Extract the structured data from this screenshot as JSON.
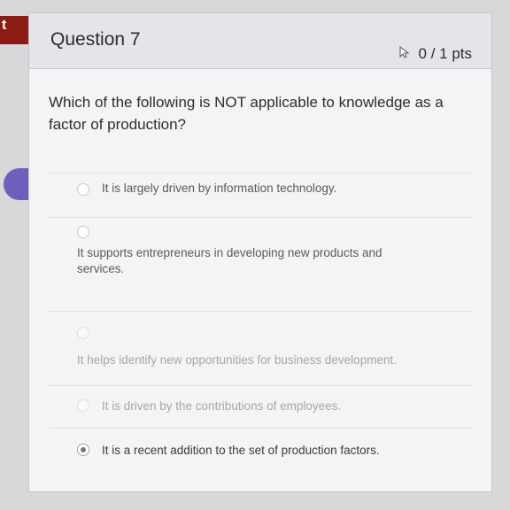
{
  "page": {
    "left_tab_label": "t",
    "question_number": "Question 7",
    "points": "0 / 1 pts",
    "question_text": "Which of the following is NOT applicable to knowledge as a factor of production?"
  },
  "answers": [
    {
      "label": "It is largely driven by information technology.",
      "selected": false
    },
    {
      "label": "It supports entrepreneurs in developing new products and services.",
      "selected": false
    },
    {
      "label": "It helps identify new opportunities for business development.",
      "selected": false
    },
    {
      "label": "It is driven by the contributions of employees.",
      "selected": false
    },
    {
      "label": "It is a recent addition to the set of production factors.",
      "selected": true
    }
  ],
  "icons": {
    "points_icon": "cursor-pointer-icon"
  }
}
